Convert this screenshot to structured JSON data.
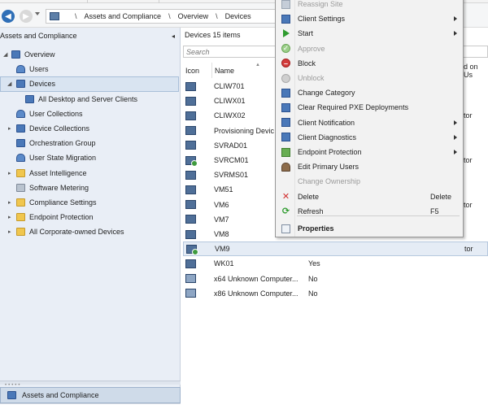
{
  "address_bar": {
    "breadcrumbs": [
      "Assets and Compliance",
      "Overview",
      "Devices"
    ],
    "separator": "\\"
  },
  "left_pane": {
    "title": "Assets and Compliance",
    "collapse_glyph": "◂",
    "tree": [
      {
        "label": "Overview",
        "expander": "◢",
        "icon": "overview-icon"
      },
      {
        "label": "Users",
        "expander": "",
        "icon": "users-icon"
      },
      {
        "label": "Devices",
        "expander": "◢",
        "icon": "devices-icon",
        "selected": true
      },
      {
        "label": "All Desktop and Server Clients",
        "expander": "",
        "icon": "device-collection-icon"
      },
      {
        "label": "User Collections",
        "expander": "",
        "icon": "user-collections-icon"
      },
      {
        "label": "Device Collections",
        "expander": "▸",
        "icon": "device-collections-icon"
      },
      {
        "label": "Orchestration Group",
        "expander": "",
        "icon": "orchestration-icon"
      },
      {
        "label": "User State Migration",
        "expander": "",
        "icon": "migration-icon"
      },
      {
        "label": "Asset Intelligence",
        "expander": "▸",
        "icon": "folder-icon"
      },
      {
        "label": "Software Metering",
        "expander": "",
        "icon": "metering-icon"
      },
      {
        "label": "Compliance Settings",
        "expander": "▸",
        "icon": "folder-icon"
      },
      {
        "label": "Endpoint Protection",
        "expander": "▸",
        "icon": "folder-icon"
      },
      {
        "label": "All Corporate-owned Devices",
        "expander": "▸",
        "icon": "folder-icon"
      }
    ],
    "wunderbar_label": "Assets and Compliance"
  },
  "main": {
    "title": "Devices 15 items",
    "search_placeholder": "Search",
    "columns": {
      "icon": "Icon",
      "name": "Name",
      "right_clip": "d on Us"
    },
    "rows": [
      {
        "name": "CLIW701",
        "value": "",
        "right": "",
        "icon": "plain"
      },
      {
        "name": "CLIWX01",
        "value": "",
        "right": "",
        "icon": "plain"
      },
      {
        "name": "CLIWX02",
        "value": "",
        "right": "tor",
        "icon": "plain"
      },
      {
        "name": "Provisioning Devic",
        "value": "",
        "right": "",
        "icon": "plain"
      },
      {
        "name": "SVRAD01",
        "value": "",
        "right": "",
        "icon": "plain"
      },
      {
        "name": "SVRCM01",
        "value": "",
        "right": "tor",
        "icon": "ok"
      },
      {
        "name": "SVRMS01",
        "value": "",
        "right": "",
        "icon": "plain"
      },
      {
        "name": "VM51",
        "value": "",
        "right": "",
        "icon": "plain"
      },
      {
        "name": "VM6",
        "value": "",
        "right": "tor",
        "icon": "plain"
      },
      {
        "name": "VM7",
        "value": "",
        "right": "",
        "icon": "plain"
      },
      {
        "name": "VM8",
        "value": "",
        "right": "",
        "icon": "plain"
      },
      {
        "name": "VM9",
        "value": "",
        "right": "tor",
        "icon": "ok",
        "selected": true
      },
      {
        "name": "WK01",
        "value": "Yes",
        "right": "",
        "icon": "plain"
      },
      {
        "name": "x64 Unknown Computer...",
        "value": "No",
        "right": "",
        "icon": "unk"
      },
      {
        "name": "x86 Unknown Computer...",
        "value": "No",
        "right": "",
        "icon": "unk"
      }
    ]
  },
  "context_menu": {
    "items": [
      {
        "label": "Reassign Site",
        "icon": "reassign-site-icon",
        "disabled": true,
        "submenu": false,
        "key": ""
      },
      {
        "label": "Client Settings",
        "icon": "client-settings-icon",
        "disabled": false,
        "submenu": true,
        "key": ""
      },
      {
        "label": "Start",
        "icon": "start-icon",
        "disabled": false,
        "submenu": true,
        "key": ""
      },
      {
        "label": "Approve",
        "icon": "approve-icon",
        "disabled": true,
        "submenu": false,
        "key": ""
      },
      {
        "label": "Block",
        "icon": "block-icon",
        "disabled": false,
        "submenu": false,
        "key": ""
      },
      {
        "label": "Unblock",
        "icon": "unblock-icon",
        "disabled": true,
        "submenu": false,
        "key": ""
      },
      {
        "label": "Change Category",
        "icon": "change-category-icon",
        "disabled": false,
        "submenu": false,
        "key": ""
      },
      {
        "label": "Clear Required PXE Deployments",
        "icon": "clear-pxe-icon",
        "disabled": false,
        "submenu": false,
        "key": ""
      },
      {
        "label": "Client Notification",
        "icon": "client-notification-icon",
        "disabled": false,
        "submenu": true,
        "key": ""
      },
      {
        "label": "Client Diagnostics",
        "icon": "client-diagnostics-icon",
        "disabled": false,
        "submenu": true,
        "key": ""
      },
      {
        "label": "Endpoint Protection",
        "icon": "endpoint-protection-icon",
        "disabled": false,
        "submenu": true,
        "key": ""
      },
      {
        "label": "Edit Primary Users",
        "icon": "edit-primary-users-icon",
        "disabled": false,
        "submenu": false,
        "key": ""
      },
      {
        "label": "Change Ownership",
        "icon": "",
        "disabled": true,
        "submenu": false,
        "key": ""
      },
      {
        "label": "Delete",
        "icon": "delete-icon",
        "disabled": false,
        "submenu": false,
        "key": "Delete"
      },
      {
        "label": "Refresh",
        "icon": "refresh-icon",
        "disabled": false,
        "submenu": false,
        "key": "F5"
      },
      {
        "label": "Properties",
        "icon": "properties-icon",
        "disabled": false,
        "submenu": false,
        "key": "",
        "bold": true
      }
    ]
  },
  "colors": {
    "accent": "#2f6fb7",
    "selection": "#d9e4f1",
    "pane_bg": "#e9eef6",
    "menu_bg": "#f2f2f2"
  }
}
